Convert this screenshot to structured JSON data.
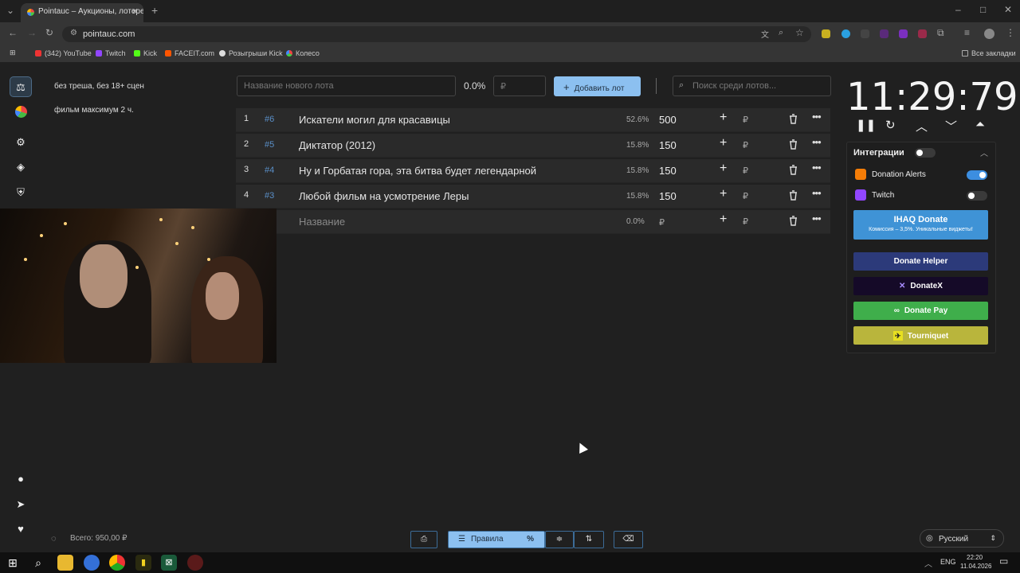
{
  "browser": {
    "tab_title": "Pointauc – Аукционы, лотереи",
    "url": "pointauc.com",
    "bookmarks": [
      "(342) YouTube",
      "Twitch",
      "Kick",
      "FACEIT.com",
      "Розыгрыши Kick",
      "Колесо"
    ],
    "all_bookmarks": "Все закладки"
  },
  "rules": [
    "без треша, без 18+ сцен",
    "фильм максимум 2 ч."
  ],
  "toolbar": {
    "new_lot_placeholder": "Название нового лота",
    "percent": "0.0%",
    "amount_placeholder": "₽",
    "add_button": "Добавить лот",
    "search_placeholder": "Поиск среди лотов..."
  },
  "lots": [
    {
      "n": "1",
      "id": "#6",
      "name": "Искатели могил для красавицы",
      "pct": "52.6%",
      "amount": "500"
    },
    {
      "n": "2",
      "id": "#5",
      "name": "Диктатор (2012)",
      "pct": "15.8%",
      "amount": "150"
    },
    {
      "n": "3",
      "id": "#4",
      "name": "Ну и Горбатая гора, эта битва будет легендарной",
      "pct": "15.8%",
      "amount": "150"
    },
    {
      "n": "4",
      "id": "#3",
      "name": "Любой фильм на усмотрение Леры",
      "pct": "15.8%",
      "amount": "150"
    }
  ],
  "empty_row": {
    "name": "Название",
    "pct": "0.0%",
    "currency": "₽"
  },
  "timer": "11:29:79",
  "integrations": {
    "title": "Интеграции",
    "donation_alerts": "Donation Alerts",
    "twitch": "Twitch",
    "ihaq": "IHAQ Donate",
    "ihaq_sub": "Комиссия – 3,5%. Уникальные виджеты!",
    "donate_helper": "Donate Helper",
    "donatex": "DonateX",
    "donate_pay": "Donate Pay",
    "tourniquet": "Tourniquet"
  },
  "footer": {
    "total": "Всего: 950,00 ₽",
    "rules_button": "Правила",
    "language": "Русский"
  },
  "taskbar": {
    "lang": "ENG",
    "time": "22:20",
    "date": "11.04.2026"
  },
  "colors": {
    "accent": "#8cc0f0",
    "toggle_on": "#3c8ee0"
  }
}
